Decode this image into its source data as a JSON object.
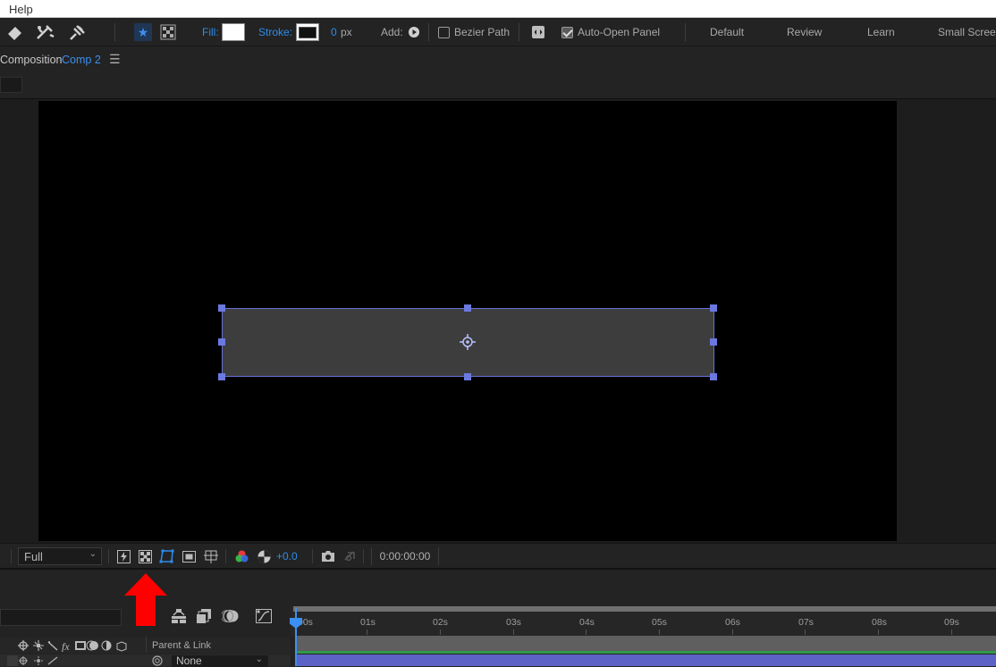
{
  "menu": {
    "help": "Help"
  },
  "toolbar": {
    "fill_label": "Fill:",
    "stroke_label": "Stroke:",
    "stroke_width": "0",
    "stroke_unit": "px",
    "add_label": "Add:",
    "bezier_label": "Bezier Path",
    "bezier_checked": false,
    "auto_open_label": "Auto-Open Panel",
    "auto_open_checked": true,
    "workspaces": [
      "Default",
      "Review",
      "Learn",
      "Small Screen"
    ]
  },
  "composition": {
    "panel_label": "Composition",
    "comp_name": "Comp 2"
  },
  "viewer_bar": {
    "resolution": "Full",
    "exposure": "+0.0",
    "timecode": "0:00:00:00"
  },
  "timeline": {
    "ticks": [
      "00s",
      "01s",
      "02s",
      "03s",
      "04s",
      "05s",
      "06s",
      "07s",
      "08s",
      "09s"
    ],
    "parent_link_header": "Parent & Link",
    "parent_value": "None"
  },
  "colors": {
    "accent": "#2d8ceb",
    "selection": "#6b78e0",
    "layer_bar": "#5d63c6",
    "annotation_arrow": "#ff0000"
  }
}
